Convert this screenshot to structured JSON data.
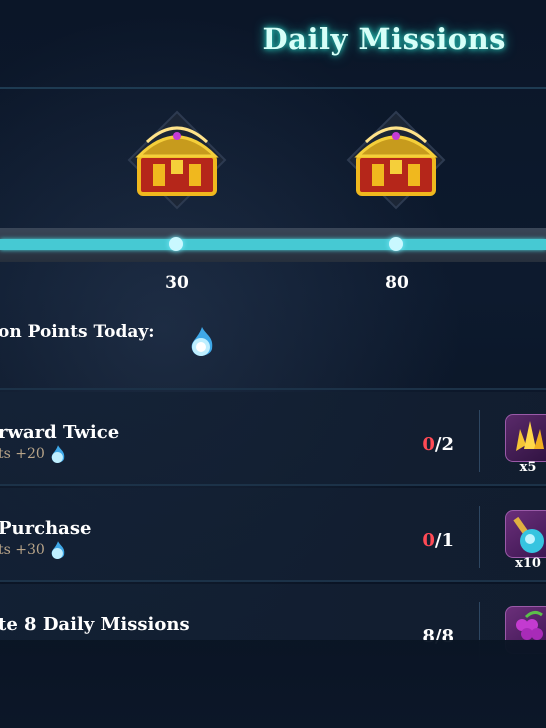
{
  "header": {
    "title": "Daily Missions"
  },
  "progress": {
    "milestones": [
      {
        "value": "30"
      },
      {
        "value": "80"
      }
    ],
    "fill_fraction": 1.0
  },
  "points": {
    "label": "on Points Today:",
    "icon": "blue-flame-icon"
  },
  "missions": [
    {
      "name": "rward Twice",
      "reward": "ts +20",
      "current": "0",
      "total": "/2",
      "item_icon": "gold-crystal-icon",
      "item_qty": "x5"
    },
    {
      "name": "Purchase",
      "reward": "ts +30",
      "current": "0",
      "total": "/1",
      "item_icon": "potion-icon",
      "item_qty": "x10"
    },
    {
      "name": "te 8 Daily Missions",
      "reward": "",
      "current": "8",
      "total": "/8",
      "item_icon": "grape-icon",
      "item_qty": ""
    }
  ],
  "colors": {
    "accent": "#46c9d3",
    "incomplete": "#ff4a55",
    "reward_text": "#b8a489"
  }
}
